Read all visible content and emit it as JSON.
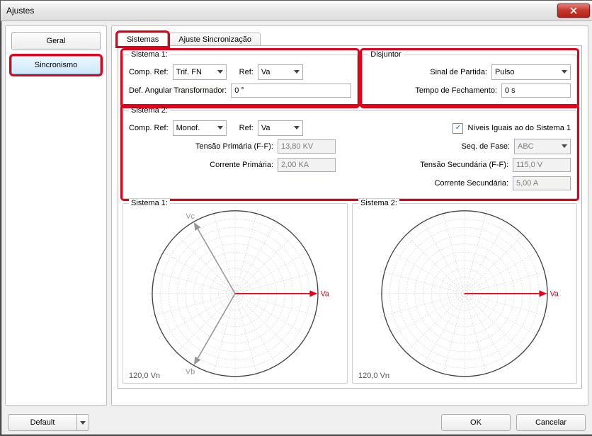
{
  "window": {
    "title": "Ajustes"
  },
  "sidebar": {
    "items": [
      {
        "label": "Geral"
      },
      {
        "label": "Sincronismo"
      }
    ]
  },
  "tabs": {
    "items": [
      {
        "label": "Sistemas"
      },
      {
        "label": "Ajuste Sincronização"
      }
    ]
  },
  "sistema1": {
    "legend": "Sistema 1:",
    "comp_ref_label": "Comp. Ref:",
    "comp_ref_value": "Trif. FN",
    "ref_label": "Ref:",
    "ref_value": "Va",
    "def_ang_label": "Def. Angular Transformador:",
    "def_ang_value": "0 °"
  },
  "disjuntor": {
    "legend": "Disjuntor",
    "sinal_label": "Sinal de Partida:",
    "sinal_value": "Pulso",
    "tempo_label": "Tempo de Fechamento:",
    "tempo_value": "0 s"
  },
  "sistema2": {
    "legend": "Sistema 2:",
    "comp_ref_label": "Comp. Ref:",
    "comp_ref_value": "Monof.",
    "ref_label": "Ref:",
    "ref_value": "Va",
    "niveis_iguais_label": "Níveis Iguais ao do Sistema 1",
    "niveis_iguais_checked": true,
    "seq_fase_label": "Seq. de Fase:",
    "seq_fase_value": "ABC",
    "tensao_prim_label": "Tensão Primária (F-F):",
    "tensao_prim_value": "13,80 KV",
    "tensao_sec_label": "Tensão Secundária (F-F):",
    "tensao_sec_value": "115,0 V",
    "corrente_prim_label": "Corrente Primária:",
    "corrente_prim_value": "2,00 KA",
    "corrente_sec_label": "Corrente Secundária:",
    "corrente_sec_value": "5,00 A"
  },
  "polar": {
    "left_title": "Sistema 1:",
    "right_title": "Sistema 2:",
    "scale_label": "120,0 Vn",
    "phasors": {
      "Va": {
        "label": "Va",
        "angle_deg": 0,
        "color": "#e2001a"
      },
      "Vb": {
        "label": "Vb",
        "angle_deg": 240,
        "color": "#969696"
      },
      "Vc": {
        "label": "Vc",
        "angle_deg": 120,
        "color": "#969696"
      }
    }
  },
  "footer": {
    "default_label": "Default",
    "ok_label": "OK",
    "cancel_label": "Cancelar"
  },
  "chart_data": [
    {
      "type": "polar-phasor",
      "title": "Sistema 1",
      "radial_max": 120.0,
      "radial_unit": "Vn",
      "series": [
        {
          "name": "Va",
          "angle_deg": 0,
          "magnitude": 120.0
        },
        {
          "name": "Vb",
          "angle_deg": 240,
          "magnitude": 120.0
        },
        {
          "name": "Vc",
          "angle_deg": 120,
          "magnitude": 120.0
        }
      ]
    },
    {
      "type": "polar-phasor",
      "title": "Sistema 2",
      "radial_max": 120.0,
      "radial_unit": "Vn",
      "series": [
        {
          "name": "Va",
          "angle_deg": 0,
          "magnitude": 120.0
        }
      ]
    }
  ]
}
